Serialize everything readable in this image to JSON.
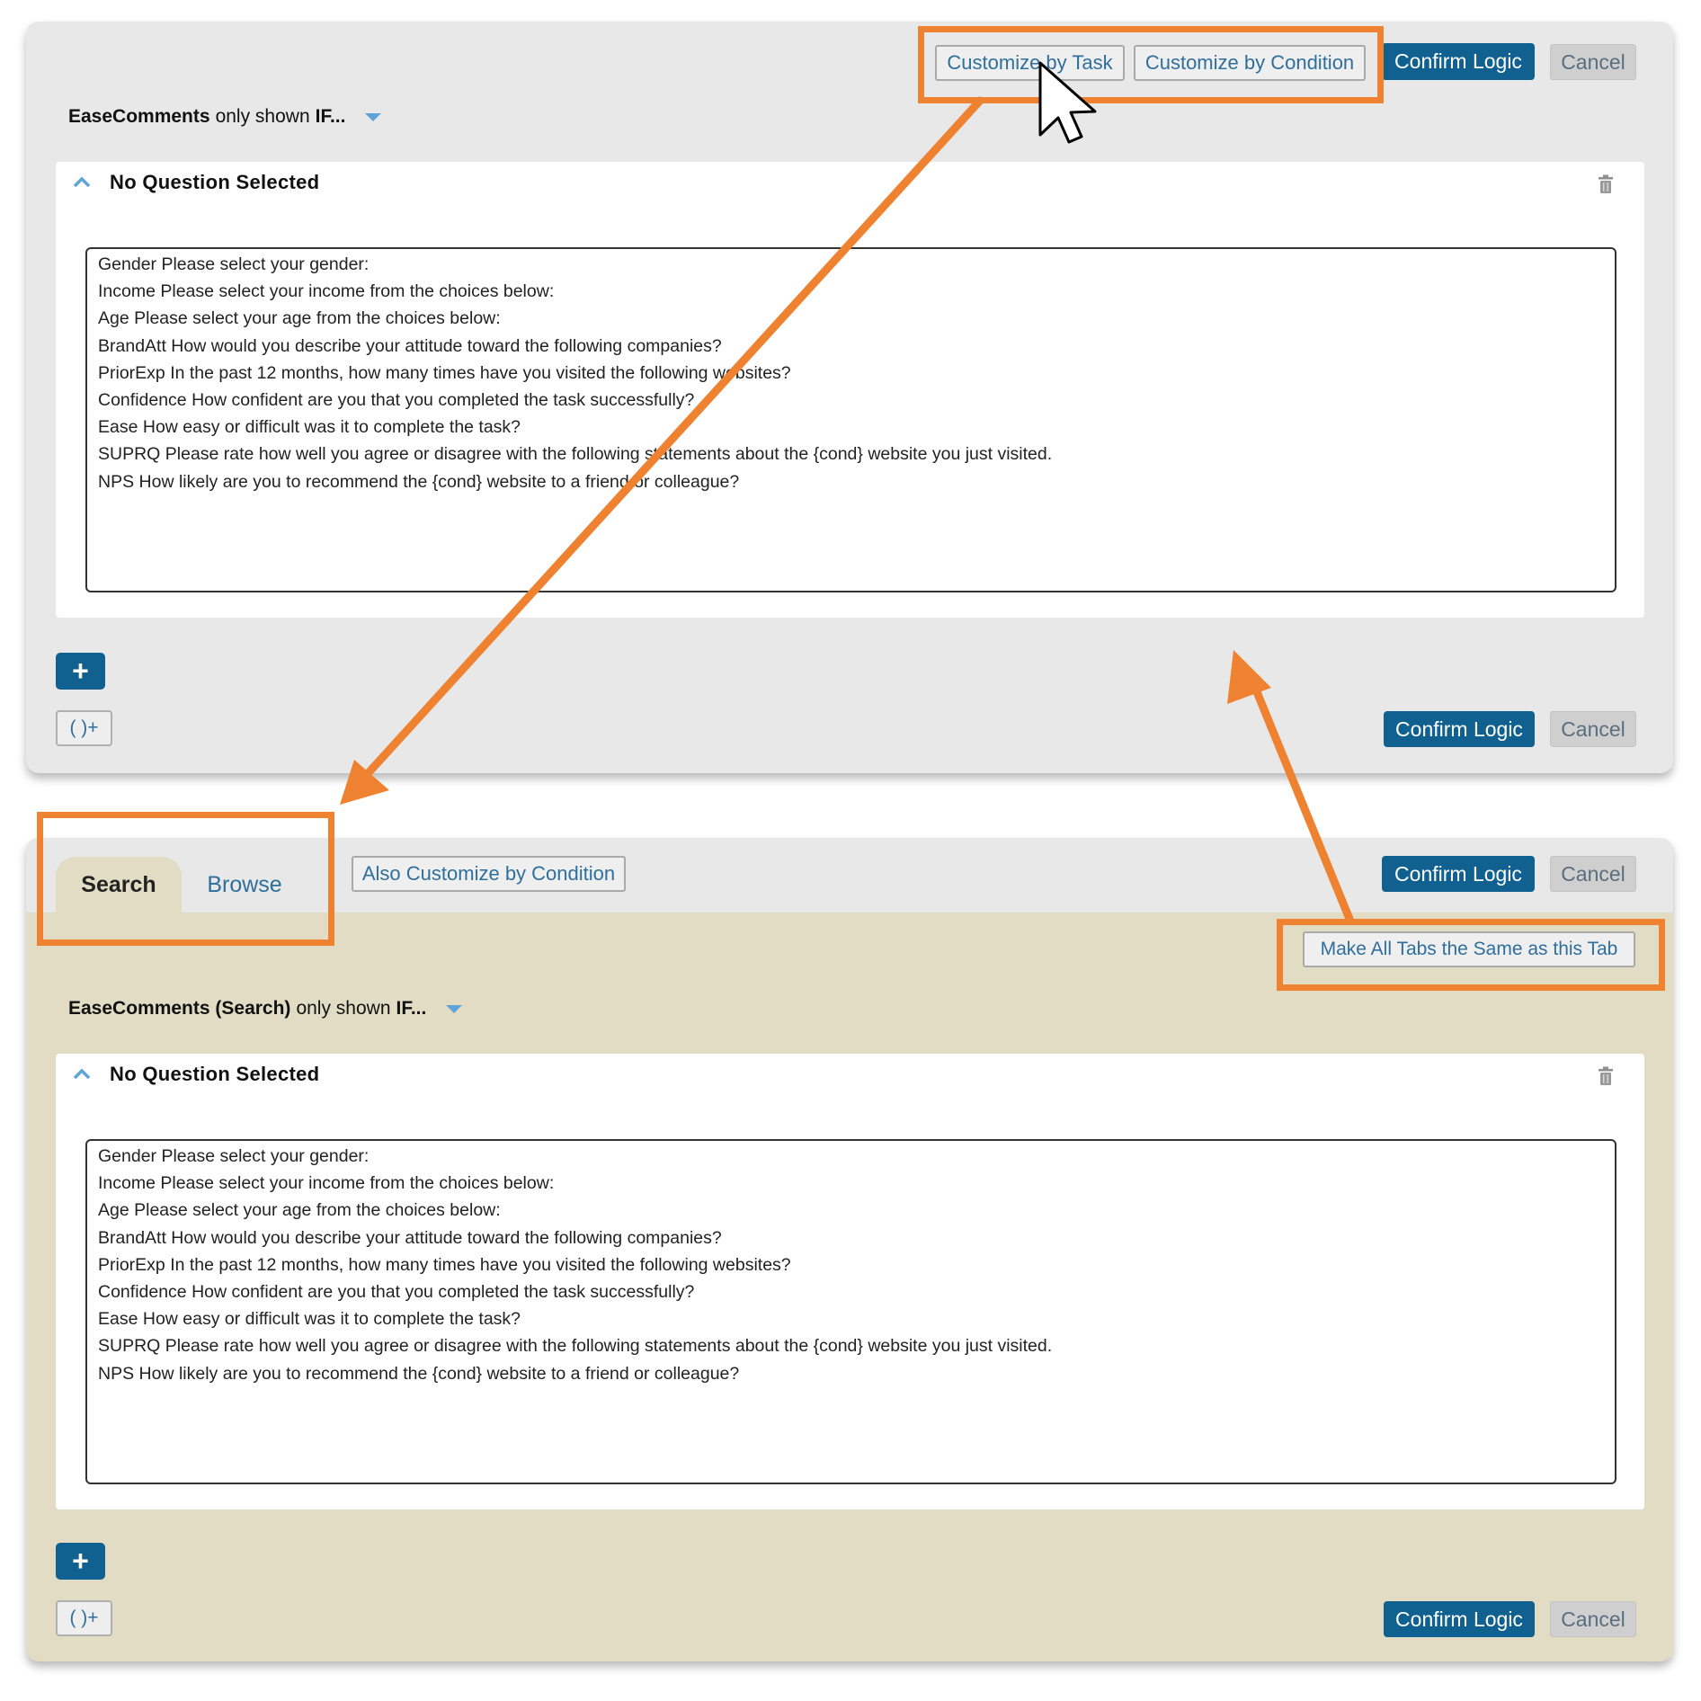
{
  "panel_default": {
    "header": {
      "customize_by_task": "Customize by Task",
      "customize_by_condition": "Customize by Condition",
      "confirm": "Confirm Logic",
      "cancel": "Cancel"
    },
    "logic_row": {
      "question": "EaseComments",
      "middle": "only shown",
      "condition": "IF..."
    },
    "card": {
      "title": "No Question Selected",
      "questions": [
        "Gender Please select your gender:",
        "Income Please select your income from the choices below:",
        "Age Please select your age from the choices below:",
        "BrandAtt How would you describe your attitude toward the following companies?",
        "PriorExp In the past 12 months, how many times have you visited the following websites?",
        "Confidence How confident are you that you completed the task successfully?",
        "Ease How easy or difficult was it to complete the task?",
        "SUPRQ Please rate how well you agree or disagree with the following statements about the {cond} website you just visited.",
        "NPS How likely are you to recommend the {cond} website to a friend or colleague?"
      ]
    },
    "add_label": "+",
    "group_label": "( )+",
    "footer": {
      "confirm": "Confirm Logic",
      "cancel": "Cancel"
    }
  },
  "panel_task": {
    "tabs": [
      {
        "label": "Search",
        "active": true
      },
      {
        "label": "Browse",
        "active": false
      }
    ],
    "also_customize_by_condition": "Also Customize by Condition",
    "header": {
      "confirm": "Confirm Logic",
      "cancel": "Cancel"
    },
    "make_all_tabs_same": "Make All Tabs the Same as this Tab",
    "logic_row": {
      "question": "EaseComments (Search)",
      "middle": "only shown",
      "condition": "IF..."
    },
    "card": {
      "title": "No Question Selected",
      "questions": [
        "Gender Please select your gender:",
        "Income Please select your income from the choices below:",
        "Age Please select your age from the choices below:",
        "BrandAtt How would you describe your attitude toward the following companies?",
        "PriorExp In the past 12 months, how many times have you visited the following websites?",
        "Confidence How confident are you that you completed the task successfully?",
        "Ease How easy or difficult was it to complete the task?",
        "SUPRQ Please rate how well you agree or disagree with the following statements about the {cond} website you just visited.",
        "NPS How likely are you to recommend the {cond} website to a friend or colleague?"
      ]
    },
    "add_label": "+",
    "group_label": "( )+",
    "footer": {
      "confirm": "Confirm Logic",
      "cancel": "Cancel"
    }
  },
  "colors": {
    "primary": "#10618f",
    "annotation": "#ee8230",
    "panel_gray": "#e8e8e8",
    "panel_tan": "#e3dcc4",
    "link_blue": "#2f6f9c"
  }
}
